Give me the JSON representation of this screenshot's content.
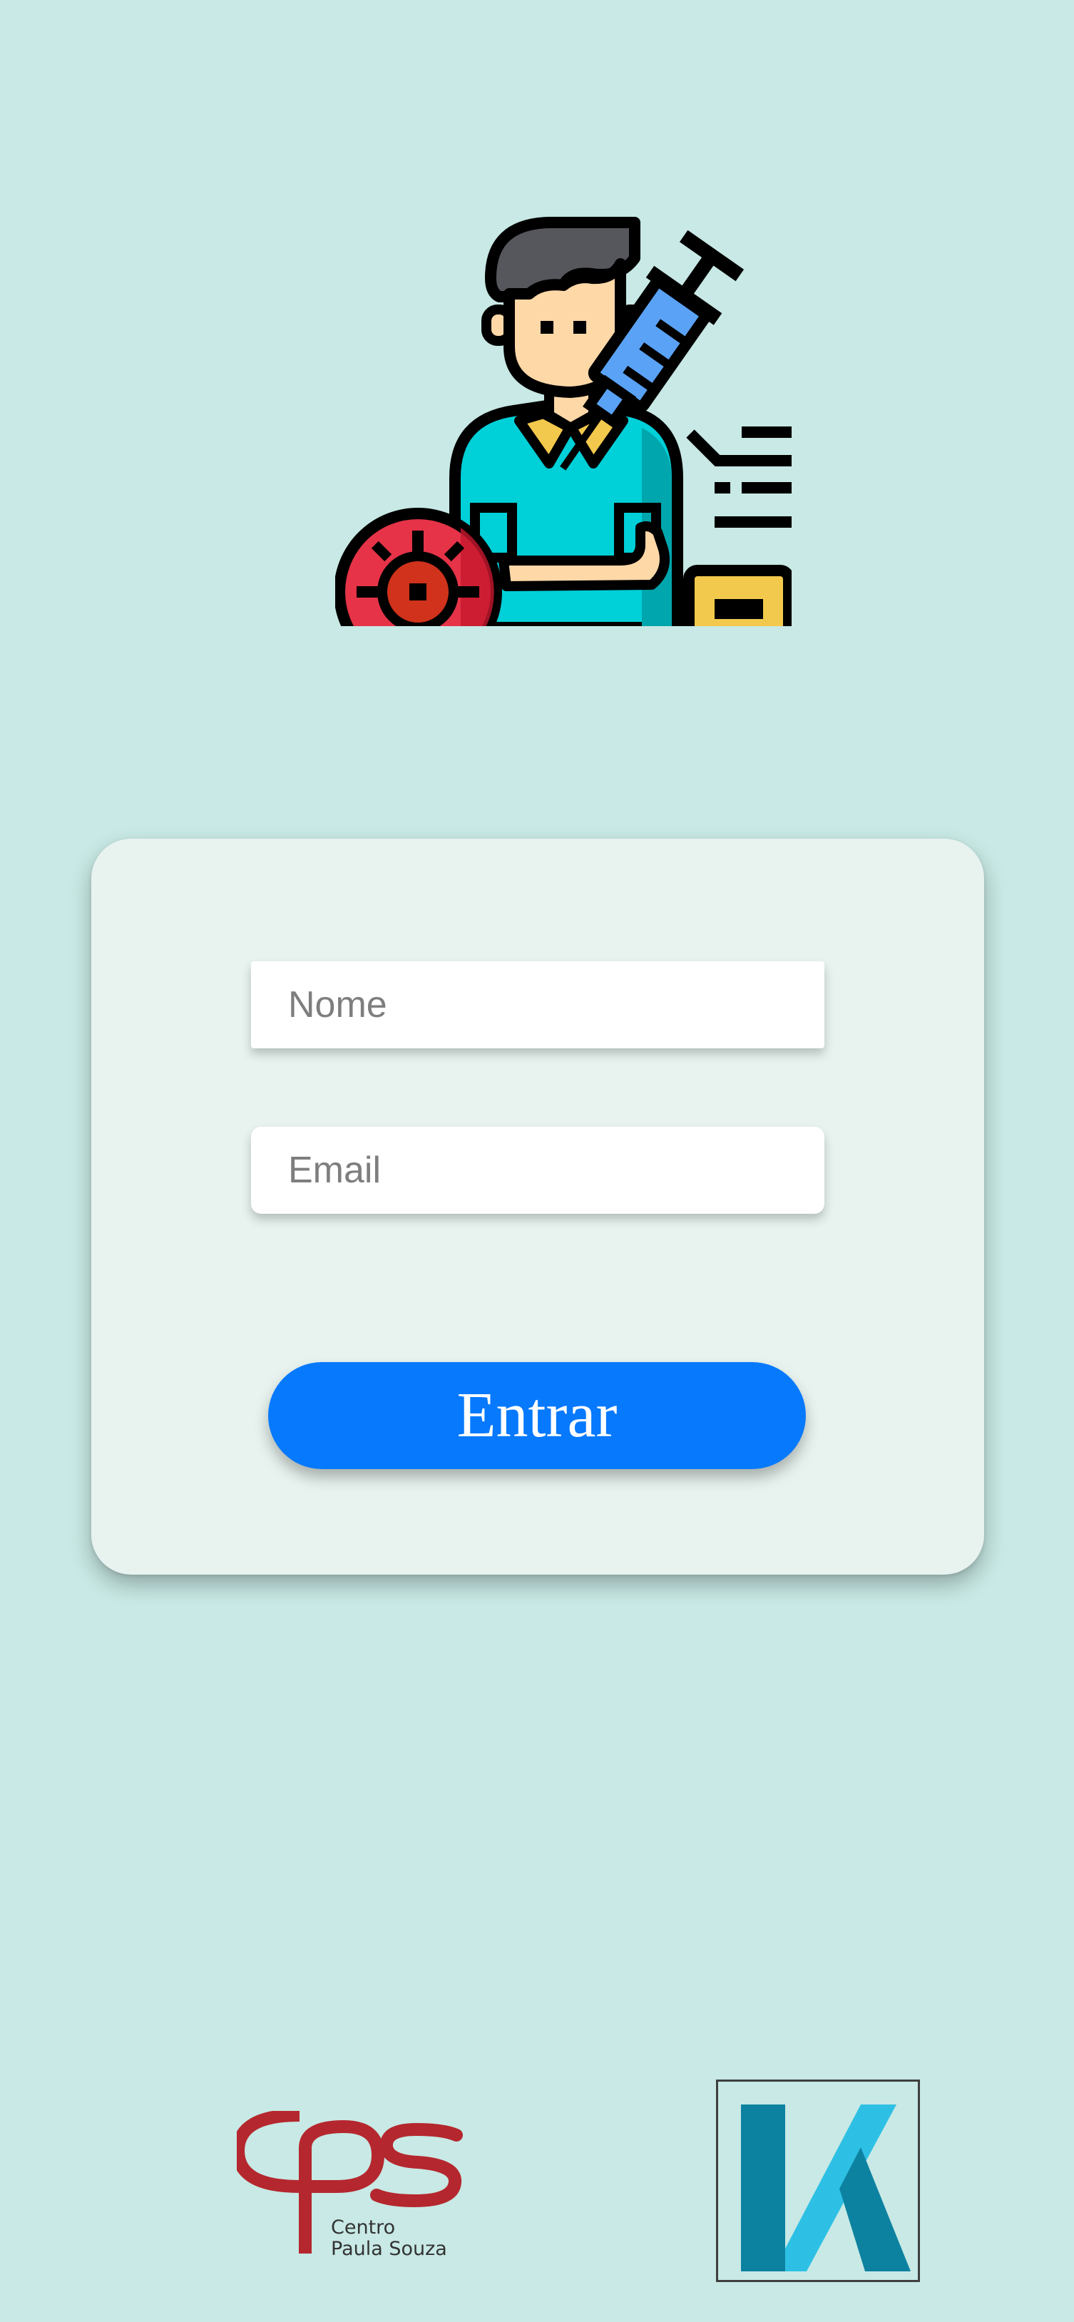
{
  "hero": {
    "icon": "doctor-vaccine-syringe-virus-illustration"
  },
  "form": {
    "name_placeholder": "Nome",
    "email_placeholder": "Email",
    "submit_label": "Entrar"
  },
  "footer": {
    "cps_logo_text": "Centro Paula Souza",
    "k_logo": "k-logo"
  },
  "colors": {
    "background": "#c8e9e5",
    "card": "#e8f3ef",
    "button": "#0779fd",
    "cps_red": "#b5272e",
    "k_blue_dark": "#0d82a0",
    "k_blue_light": "#2ec0e4"
  }
}
